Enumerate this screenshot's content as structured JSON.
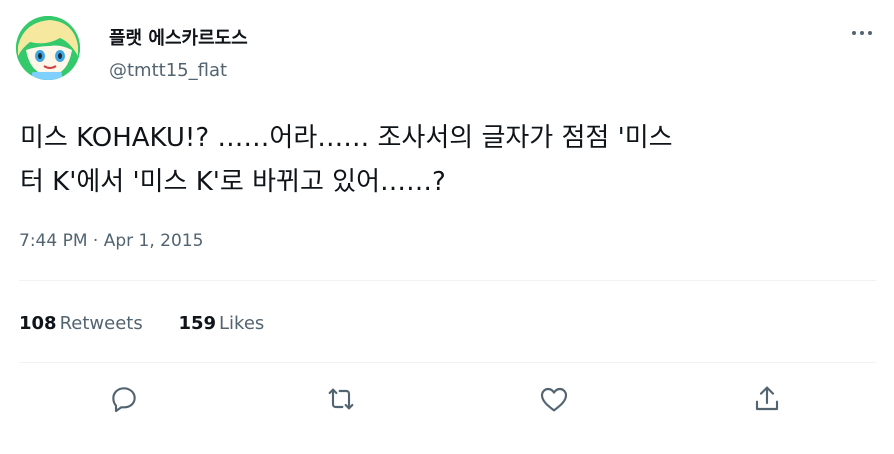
{
  "user": {
    "display_name": "플랫 에스카르도스",
    "handle": "@tmtt15_flat",
    "avatar_icon": "anime-avatar"
  },
  "menu": {
    "more_icon": "more-horizontal-icon"
  },
  "tweet": {
    "text": "미스 KOHAKU!? ……어라…… 조사서의 글자가 점점 '미스\n터 K'에서 '미스 K'로 바뀌고 있어……?",
    "timestamp": "7:44 PM · Apr 1, 2015"
  },
  "stats": {
    "retweets_count": "108",
    "retweets_label": "Retweets",
    "likes_count": "159",
    "likes_label": "Likes"
  },
  "actions": [
    "reply-icon",
    "retweet-icon",
    "like-icon",
    "share-icon"
  ],
  "colors": {
    "text_primary": "#0f1419",
    "text_secondary": "#536471",
    "divider": "#eff3f4",
    "icon": "#536471"
  }
}
